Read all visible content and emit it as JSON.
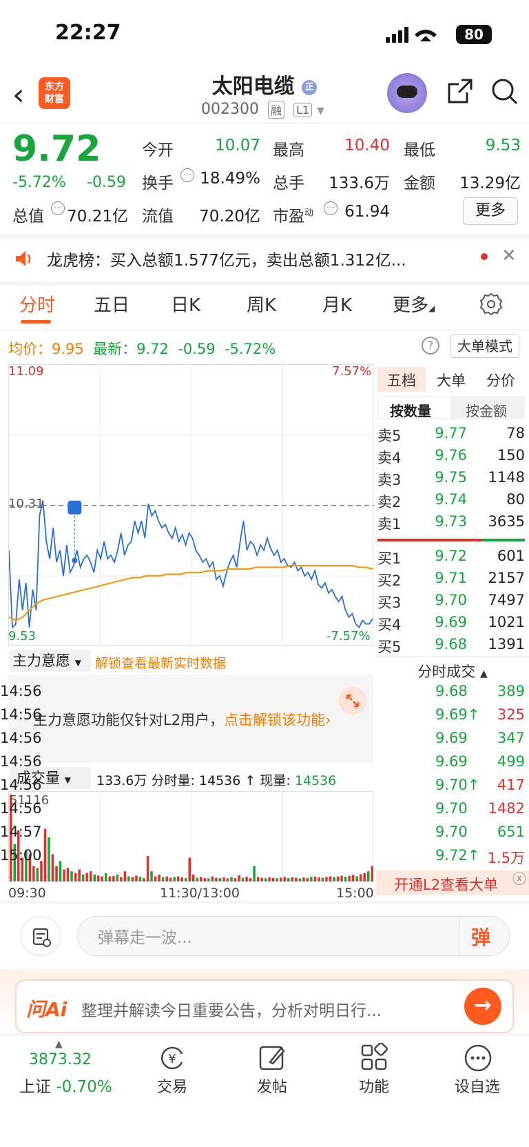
{
  "status": {
    "time": "22:27",
    "battery": "80"
  },
  "header": {
    "logo_line1": "东方",
    "logo_line2": "财富",
    "name": "太阳电缆",
    "name_badge": "正",
    "code": "002300",
    "tag1": "融",
    "tag2": "L1"
  },
  "quote": {
    "price": "9.72",
    "pct": "-5.72%",
    "change": "-0.59",
    "open_label": "今开",
    "open": "10.07",
    "high_label": "最高",
    "high": "10.40",
    "low_label": "最低",
    "low": "9.53",
    "turnover_label": "换手",
    "turnover": "18.49%",
    "volume_label": "总手",
    "volume": "133.6万",
    "amount_label": "金额",
    "amount": "13.29亿",
    "mcap_label": "总值",
    "mcap": "70.21亿",
    "float_label": "流值",
    "float": "70.20亿",
    "pe_label": "市盈",
    "pe_sup": "动",
    "pe": "61.94",
    "more": "更多"
  },
  "notice": {
    "text": "龙虎榜：买入总额1.577亿元，卖出总额1.312亿..."
  },
  "tabs": [
    "分时",
    "五日",
    "日K",
    "周K",
    "月K",
    "更多"
  ],
  "infoline": {
    "avg_label": "均价：",
    "avg": "9.95",
    "latest_label": "最新：",
    "latest": "9.72",
    "change": "-0.59",
    "pct": "-5.72%",
    "help": "?",
    "bigorder": "大单模式"
  },
  "chart_data": {
    "type": "line",
    "title": "",
    "y_top": "11.09",
    "y_bottom": "9.53",
    "pct_top": "7.57%",
    "pct_bottom": "-7.57%",
    "ref_label": "10.31",
    "ylim": [
      9.53,
      11.09
    ],
    "x_ticks": [
      "09:30",
      "11:30/13:00",
      "15:00"
    ],
    "series": [
      {
        "values": [
          10.05,
          9.6,
          9.62,
          9.88,
          9.7,
          9.86,
          9.6,
          9.82,
          9.7,
          10.25,
          10.34,
          10.1,
          10.0,
          10.18,
          9.98,
          10.05,
          9.9,
          10.08,
          9.92,
          9.96,
          10.05,
          9.95,
          10.0,
          10.02,
          9.98,
          9.92,
          10.05,
          10.0,
          10.1,
          10.0,
          10.02,
          9.98,
          10.05,
          10.15,
          10.02,
          10.08,
          10.1,
          10.22,
          10.15,
          10.22,
          10.12,
          10.32,
          10.25,
          10.28,
          10.22,
          10.18,
          10.2,
          10.15,
          10.12,
          10.18,
          10.1,
          10.14,
          10.08,
          10.15,
          10.12,
          10.05,
          10.02,
          9.98,
          10.0,
          9.95,
          9.98,
          9.88,
          9.9,
          9.84,
          9.92,
          9.98,
          10.02,
          9.95,
          10.1,
          10.22,
          10.05,
          10.1,
          10.08,
          10.02,
          10.08,
          10.05,
          10.12,
          10.06,
          10.02,
          10.05,
          9.98,
          10.0,
          9.96,
          9.95,
          9.98,
          9.93,
          9.95,
          9.9,
          9.92,
          9.88,
          9.93,
          9.85,
          9.83,
          9.86,
          9.8,
          9.82,
          9.78,
          9.75,
          9.78,
          9.7,
          9.66,
          9.68,
          9.62,
          9.6,
          9.64,
          9.62,
          9.62,
          9.65
        ]
      },
      {
        "values": [
          9.66,
          9.64,
          9.66,
          9.7,
          9.74,
          9.76,
          9.77,
          9.78,
          9.79,
          9.8,
          9.81,
          9.82,
          9.83,
          9.84,
          9.85,
          9.86,
          9.87,
          9.88,
          9.89,
          9.89,
          9.9,
          9.9,
          9.9,
          9.91,
          9.91,
          9.91,
          9.92,
          9.92,
          9.92,
          9.93,
          9.93,
          9.93,
          9.94,
          9.94,
          9.94,
          9.94,
          9.95,
          9.95,
          9.95,
          9.95,
          9.95,
          9.96,
          9.96,
          9.96,
          9.96,
          9.96,
          9.96,
          9.96,
          9.96,
          9.96,
          9.96,
          9.95,
          9.95,
          9.94
        ]
      }
    ],
    "volume_label": "51116",
    "volume_max": 51116,
    "volumes": [
      51116,
      22000,
      30000,
      14000,
      18000,
      16000,
      9000,
      8000,
      12000,
      31000,
      26000,
      16000,
      9000,
      12000,
      7000,
      8000,
      6000,
      5000,
      7000,
      4000,
      5000,
      6000,
      4000,
      3500,
      3000,
      5000,
      3000,
      3200,
      4000,
      2500,
      6000,
      3000,
      2500,
      3500,
      2800,
      2000,
      15000,
      6000,
      3000,
      4000,
      2500,
      3000,
      2200,
      2600,
      3000,
      2400,
      2000,
      14000,
      4000,
      2200,
      2600,
      2000,
      1800,
      3000,
      2200,
      2000,
      2400,
      1900,
      2600,
      2000,
      3600,
      2200,
      2800,
      2000,
      9000,
      2600,
      2200,
      2000,
      2400,
      2100,
      1900,
      2200,
      2600,
      2000,
      2400,
      2200,
      1800,
      2300,
      2100,
      2600,
      2800,
      2400,
      2200,
      2600,
      3000,
      2600,
      2900,
      3400,
      2800,
      3200,
      3800,
      3000,
      4200,
      5000,
      6000,
      9000
    ]
  },
  "main_intention": {
    "select": "主力意愿",
    "unlock": "解锁查看最新实时数据",
    "text_prefix": "主力意愿功能仅针对L2用户，",
    "text_link": "点击解锁该功能"
  },
  "volume_bar": {
    "select": "成交量",
    "total": "133.6万",
    "tick_label": "分时量:",
    "tick_value": "14536",
    "now_label": "现量:",
    "now_value": "14536"
  },
  "orderbook": {
    "tabs": [
      "五档",
      "大单",
      "分价"
    ],
    "seg": [
      "按数量",
      "按金额"
    ],
    "asks": [
      {
        "label": "卖5",
        "price": "9.77",
        "vol": "78"
      },
      {
        "label": "卖4",
        "price": "9.76",
        "vol": "150"
      },
      {
        "label": "卖3",
        "price": "9.75",
        "vol": "1148"
      },
      {
        "label": "卖2",
        "price": "9.74",
        "vol": "80"
      },
      {
        "label": "卖1",
        "price": "9.73",
        "vol": "3635"
      }
    ],
    "bids": [
      {
        "label": "买1",
        "price": "9.72",
        "vol": "601"
      },
      {
        "label": "买2",
        "price": "9.71",
        "vol": "2157"
      },
      {
        "label": "买3",
        "price": "9.70",
        "vol": "7497"
      },
      {
        "label": "买4",
        "price": "9.69",
        "vol": "1021"
      },
      {
        "label": "买5",
        "price": "9.68",
        "vol": "1391"
      }
    ],
    "ticks_title": "分时成交",
    "ticks": [
      {
        "time": "14:56",
        "price": "9.68",
        "vol": "389",
        "arrow": "",
        "pc": "green",
        "vc": "green"
      },
      {
        "time": "14:56",
        "price": "9.69",
        "vol": "325",
        "arrow": "↑",
        "pc": "green",
        "vc": "red"
      },
      {
        "time": "14:56",
        "price": "9.69",
        "vol": "347",
        "arrow": "",
        "pc": "green",
        "vc": "green"
      },
      {
        "time": "14:56",
        "price": "9.69",
        "vol": "499",
        "arrow": "",
        "pc": "green",
        "vc": "green"
      },
      {
        "time": "14:56",
        "price": "9.70",
        "vol": "417",
        "arrow": "↑",
        "pc": "green",
        "vc": "red"
      },
      {
        "time": "14:56",
        "price": "9.70",
        "vol": "1482",
        "arrow": "",
        "pc": "green",
        "vc": "red"
      },
      {
        "time": "14:57",
        "price": "9.70",
        "vol": "651",
        "arrow": "",
        "pc": "green",
        "vc": "green"
      },
      {
        "time": "15:00",
        "price": "9.72",
        "vol": "1.5万",
        "arrow": "↑",
        "pc": "green",
        "vc": "red"
      }
    ],
    "l2_banner": "开通L2查看大单"
  },
  "danmu": {
    "placeholder": "弹幕走一波...",
    "button": "弹"
  },
  "ai": {
    "logo": "问Ai",
    "text": "整理并解读今日重要公告，分析对明日行..."
  },
  "bottom": {
    "index_value": "3873.32",
    "index_name": "上证",
    "index_pct": "-0.70%",
    "nav": [
      "交易",
      "发帖",
      "功能",
      "设自选"
    ]
  }
}
